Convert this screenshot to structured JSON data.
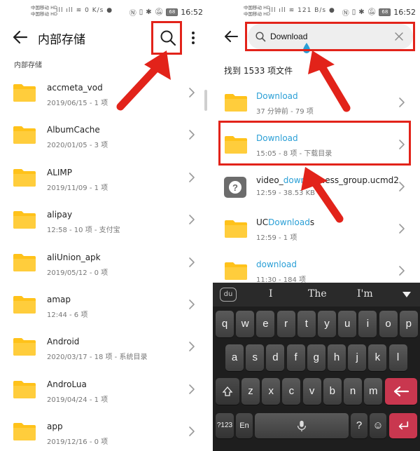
{
  "left": {
    "status": {
      "carrier1": "中国移动 HD",
      "carrier2": "中国移动 HD",
      "speed": "0 K/s",
      "battery": "68",
      "time": "16:52"
    },
    "title": "内部存储",
    "section_label": "内部存储",
    "folders": [
      {
        "name": "accmeta_vod",
        "meta": "2019/06/15 - 1 项"
      },
      {
        "name": "AlbumCache",
        "meta": "2020/01/05 - 3 项"
      },
      {
        "name": "ALIMP",
        "meta": "2019/11/09 - 1 项"
      },
      {
        "name": "alipay",
        "meta": "12:58 - 10 项 - 支付宝"
      },
      {
        "name": "aliUnion_apk",
        "meta": "2019/05/12 - 0 项"
      },
      {
        "name": "amap",
        "meta": "12:44 - 6 项"
      },
      {
        "name": "Android",
        "meta": "2020/03/17 - 18 项 - 系统目录"
      },
      {
        "name": "AndroLua",
        "meta": "2019/04/24 - 1 项"
      },
      {
        "name": "app",
        "meta": "2019/12/16 - 0 项"
      }
    ]
  },
  "right": {
    "status": {
      "carrier1": "中国移动 HD",
      "carrier2": "中国移动 HD",
      "speed": "121 B/s",
      "battery": "68",
      "time": "16:52"
    },
    "search": {
      "value": "Download"
    },
    "result_count": "找到 1533 项文件",
    "results": [
      {
        "pre": "",
        "hl": "Download",
        "post": "",
        "meta": "37 分钟前 - 79 项",
        "type": "folder"
      },
      {
        "pre": "",
        "hl": "Download",
        "post": "",
        "meta": "15:05 - 8 项 - 下载目录",
        "type": "folder"
      },
      {
        "pre": "video_",
        "hl": "down",
        "post": "l_s...ess_group.ucmd2",
        "meta": "12:59 - 38.53 KB",
        "type": "file"
      },
      {
        "pre": "UC",
        "hl": "Download",
        "post": "s",
        "meta": "12:59 - 1 项",
        "type": "folder"
      },
      {
        "pre": "",
        "hl": "download",
        "post": "",
        "meta": "11:30 - 184 项",
        "type": "folder"
      }
    ],
    "keyboard": {
      "logo": "du",
      "suggestions": [
        "I",
        "The",
        "I'm"
      ],
      "row1": [
        "q",
        "w",
        "e",
        "r",
        "t",
        "y",
        "u",
        "i",
        "o",
        "p"
      ],
      "row2": [
        "a",
        "s",
        "d",
        "f",
        "g",
        "h",
        "j",
        "k",
        "l"
      ],
      "row3": [
        "z",
        "x",
        "c",
        "v",
        "b",
        "n",
        "m"
      ],
      "num_key": "?123",
      "lang_key": "En",
      "question_key": "?",
      "emoji_key": "☺"
    }
  },
  "colors": {
    "folder": "#FFC21A",
    "highlight": "#2A9FD6",
    "annotation_red": "#E2231A",
    "enter_key": "#C9374F"
  }
}
